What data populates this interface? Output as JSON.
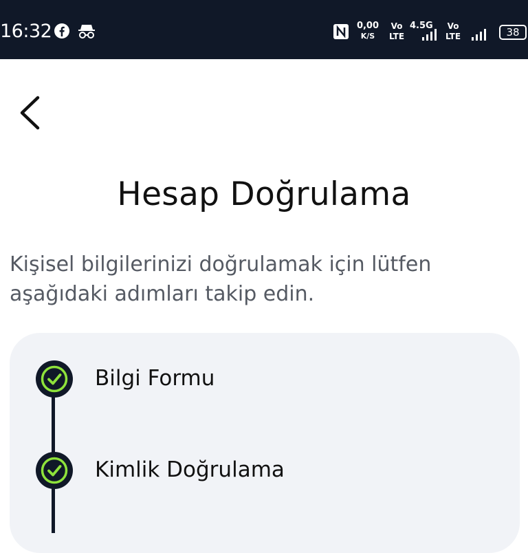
{
  "status_bar": {
    "time": "16:32",
    "net_speed_value": "0,00",
    "net_speed_unit": "K/S",
    "vo_label_1": "Vo",
    "lte_label_1": "LTE",
    "net_type": "4.5G",
    "vo_label_2": "Vo",
    "lte_label_2": "LTE",
    "battery": "38"
  },
  "page": {
    "title": "Hesap Doğrulama",
    "description": "Kişisel bilgilerinizi doğrulamak için lütfen aşağıdaki adımları takip edin."
  },
  "steps": [
    {
      "label": "Bilgi Formu",
      "status": "completed"
    },
    {
      "label": "Kimlik Doğrulama",
      "status": "completed"
    }
  ],
  "colors": {
    "status_bar_bg": "#101828",
    "check_green": "#8ee23b",
    "card_bg": "#f1f3f7"
  }
}
